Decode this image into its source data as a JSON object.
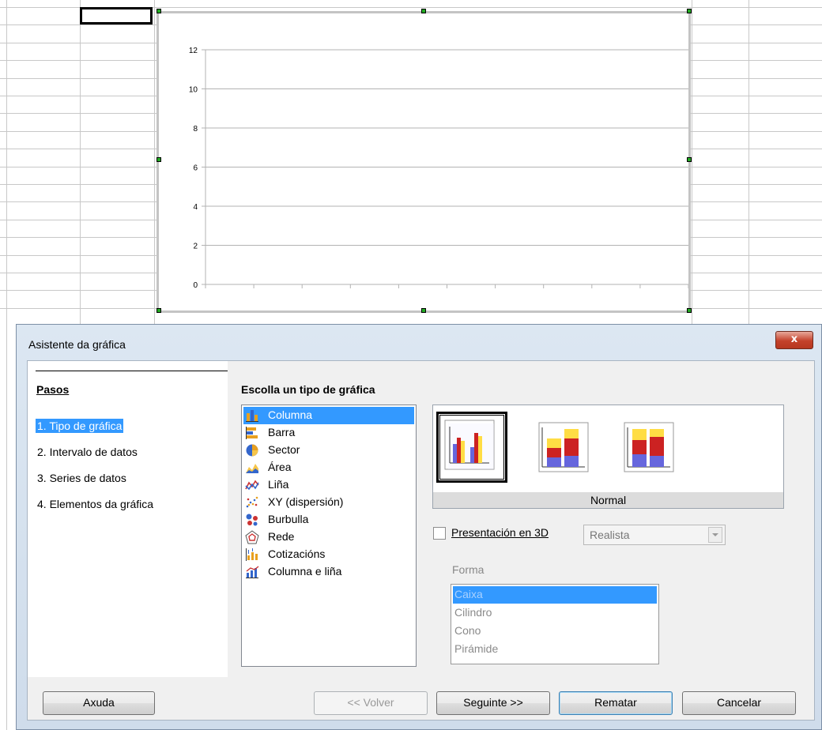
{
  "chart_data": {
    "type": "bar",
    "categories": [],
    "values": [],
    "yticks": [
      "12",
      "10",
      "8",
      "6",
      "4",
      "2",
      "0"
    ],
    "ylim": [
      0,
      12
    ],
    "grid": true,
    "xticks_count": 11
  },
  "dialog": {
    "title": "Asistente da gráfica",
    "close_label": "x",
    "steps_title": "Pasos",
    "steps": [
      {
        "label": "1. Tipo de gráfica"
      },
      {
        "label": "2. Intervalo de datos"
      },
      {
        "label": "3. Series de datos"
      },
      {
        "label": "4. Elementos da gráfica"
      }
    ],
    "main_title": "Escolla un tipo de gráfica",
    "chart_types": [
      {
        "label": "Columna",
        "icon": "column-chart-icon"
      },
      {
        "label": "Barra",
        "icon": "bar-chart-icon"
      },
      {
        "label": "Sector",
        "icon": "pie-chart-icon"
      },
      {
        "label": "Área",
        "icon": "area-chart-icon"
      },
      {
        "label": "Liña",
        "icon": "line-chart-icon"
      },
      {
        "label": "XY (dispersión)",
        "icon": "scatter-chart-icon"
      },
      {
        "label": "Burbulla",
        "icon": "bubble-chart-icon"
      },
      {
        "label": "Rede",
        "icon": "net-chart-icon"
      },
      {
        "label": "Cotizacións",
        "icon": "stock-chart-icon"
      },
      {
        "label": "Columna e liña",
        "icon": "column-line-chart-icon"
      }
    ],
    "variant_caption": "Normal",
    "threed_label": "Presentación en 3D",
    "threed_combo_value": "Realista",
    "shape_label": "Forma",
    "shapes": [
      "Caixa",
      "Cilindro",
      "Cono",
      "Pirámide"
    ],
    "buttons": {
      "help": "Axuda",
      "back": "<< Volver",
      "next": "Seguinte >>",
      "finish": "Rematar",
      "cancel": "Cancelar"
    },
    "colors": {
      "selection": "#3399ff",
      "bar_blue": "#6666dd",
      "bar_red": "#cc2222",
      "bar_yellow": "#ffdd44"
    }
  }
}
